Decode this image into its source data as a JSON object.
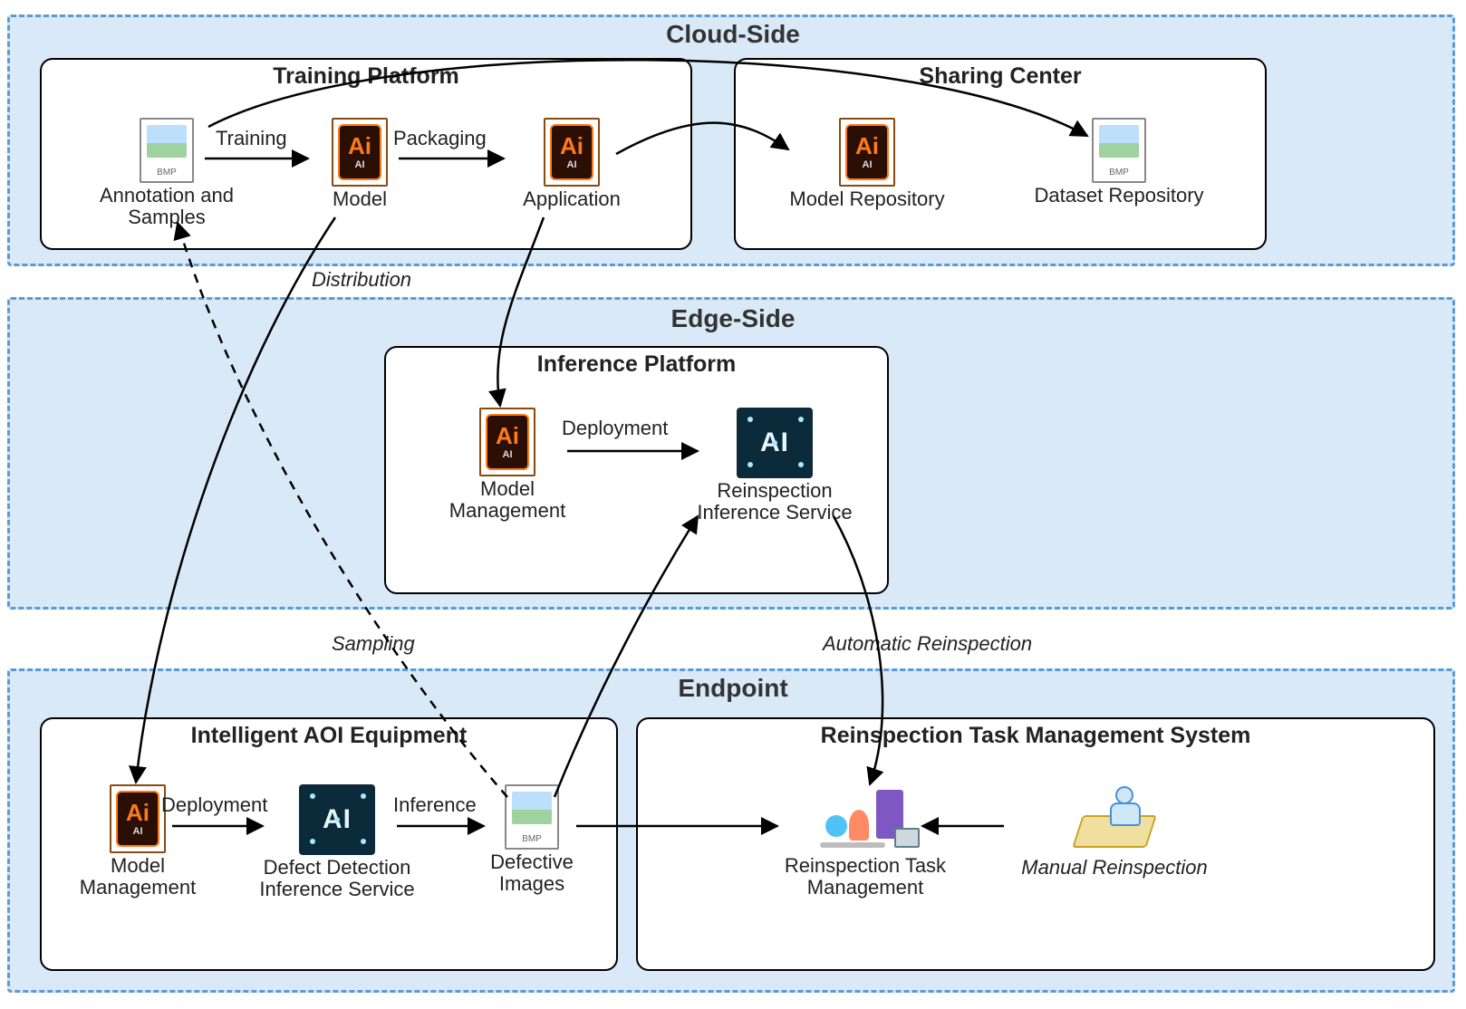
{
  "layers": {
    "cloud": {
      "title": "Cloud-Side"
    },
    "edge": {
      "title": "Edge-Side"
    },
    "endpoint": {
      "title": "Endpoint"
    }
  },
  "boxes": {
    "training_platform": {
      "title": "Training Platform"
    },
    "sharing_center": {
      "title": "Sharing Center"
    },
    "inference_platform": {
      "title": "Inference Platform"
    },
    "aoi_equipment": {
      "title": "Intelligent AOI Equipment"
    },
    "reinspection_system": {
      "title": "Reinspection Task Management System"
    }
  },
  "nodes": {
    "annotation_samples": {
      "label": "Annotation and\nSamples",
      "icon": "bmp"
    },
    "model": {
      "label": "Model",
      "icon": "aifile"
    },
    "application": {
      "label": "Application",
      "icon": "aifile"
    },
    "model_repository": {
      "label": "Model Repository",
      "icon": "aifile"
    },
    "dataset_repository": {
      "label": "Dataset Repository",
      "icon": "bmp"
    },
    "model_management_edge": {
      "label": "Model\nManagement",
      "icon": "aifile"
    },
    "reinspection_inference_service": {
      "label": "Reinspection\nInference Service",
      "icon": "ai-dark"
    },
    "model_management_endpoint": {
      "label": "Model\nManagement",
      "icon": "aifile"
    },
    "defect_detection_service": {
      "label": "Defect Detection\nInference Service",
      "icon": "ai-dark"
    },
    "defective_images": {
      "label": "Defective\nImages",
      "icon": "bmp"
    },
    "reinspection_task_management": {
      "label": "Reinspection Task\nManagement",
      "icon": "task"
    },
    "manual_reinspection": {
      "label": "Manual Reinspection",
      "icon": "person",
      "italic": true
    }
  },
  "edges": {
    "training": {
      "label": "Training"
    },
    "packaging": {
      "label": "Packaging"
    },
    "distribution": {
      "label": "Distribution",
      "italic": true
    },
    "deployment_edge": {
      "label": "Deployment"
    },
    "sampling": {
      "label": "Sampling",
      "italic": true
    },
    "automatic_reinspection": {
      "label": "Automatic Reinspection",
      "italic": true
    },
    "deployment_endpoint": {
      "label": "Deployment"
    },
    "inference": {
      "label": "Inference"
    }
  }
}
